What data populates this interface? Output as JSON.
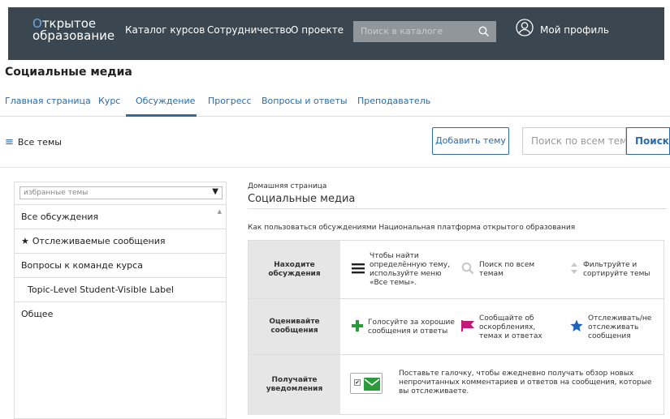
{
  "header": {
    "logo_line1_first": "О",
    "logo_line1_rest": "ткрытое",
    "logo_line2": "образование",
    "nav": [
      "Каталог курсов",
      "Сотрудничество",
      "О проекте"
    ],
    "search_placeholder": "Поиск в каталоге",
    "profile_label": "Мой профиль"
  },
  "course": {
    "title": "Социальные медиа"
  },
  "tabs": [
    {
      "label": "Главная страница",
      "active": false
    },
    {
      "label": "Курс",
      "active": false
    },
    {
      "label": "Обсуждение",
      "active": true
    },
    {
      "label": "Прогресс",
      "active": false
    },
    {
      "label": "Вопросы и ответы",
      "active": false
    },
    {
      "label": "Преподаватель",
      "active": false
    }
  ],
  "toolbar": {
    "all_topics": "Все темы",
    "add_topic": "Добавить тему",
    "search_placeholder": "Поиск по всем тем",
    "search_button": "Поиск"
  },
  "sidebar": {
    "filter_placeholder": "избранные темы",
    "items": [
      {
        "label": "Все обсуждения"
      },
      {
        "label": "Отслеживаемые сообщения"
      },
      {
        "label": "Вопросы к команде курса"
      },
      {
        "label": "Topic-Level Student-Visible Label"
      },
      {
        "label": "Общее"
      }
    ]
  },
  "main": {
    "breadcrumb": "Домашняя страница",
    "title": "Социальные медиа",
    "howto": "Как пользоваться обсуждениями Национальная платформа открытого образования",
    "rows": [
      {
        "label": "Находите обсуждения",
        "cells": [
          "Чтобы найти определённую тему, используйте меню «Все темы».",
          "Поиск по всем темам",
          "Фильтруйте и сортируйте темы"
        ]
      },
      {
        "label": "Оценивайте сообщения",
        "cells": [
          "Голосуйте за хорошие сообщения и ответы",
          "Сообщайте об оскорблениях, темах и ответах",
          "Отслеживать/не отслеживать сообщения"
        ]
      },
      {
        "label": "Получайте уведомления",
        "notify_text": "Поставьте галочку, чтобы ежедневно получать обзор новых непрочитанных комментариев и ответов на сообщения, которые вы отслеживаете."
      }
    ]
  },
  "colors": {
    "header_bg": "#3a4650",
    "accent": "#2a6ba8",
    "green": "#2a9a3a",
    "pink": "#c2187a",
    "star_blue": "#1f62b8"
  }
}
